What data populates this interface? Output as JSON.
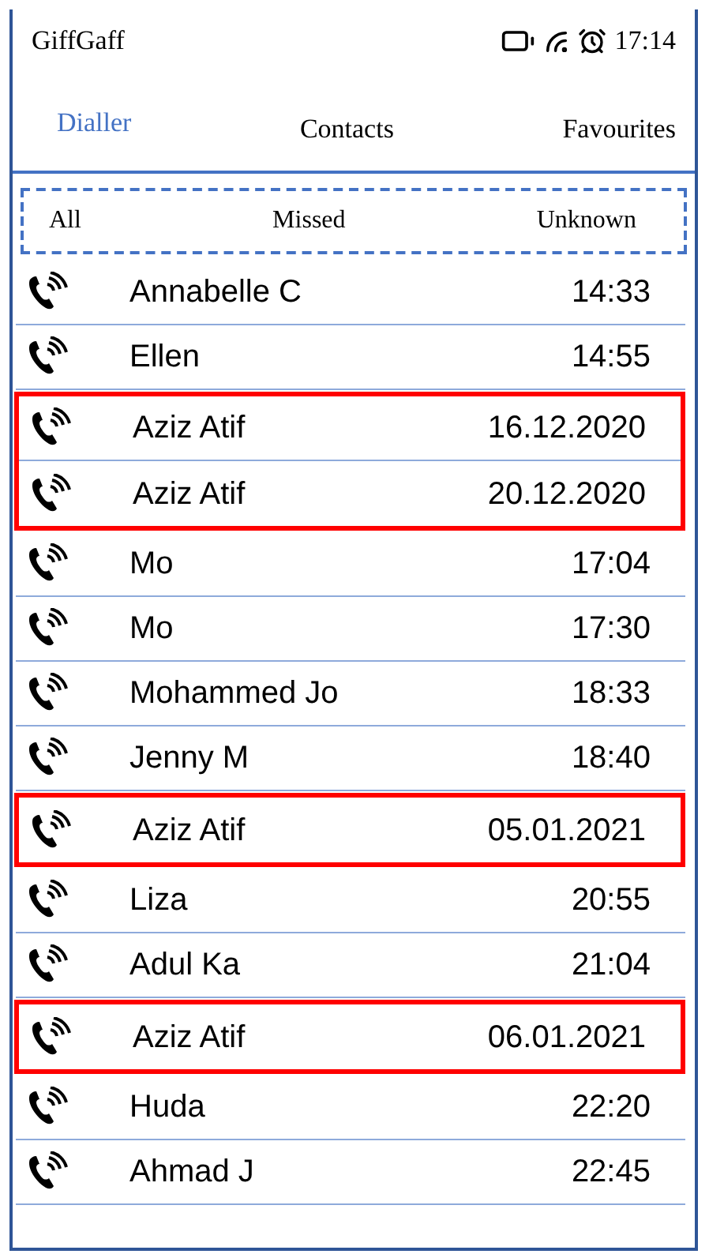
{
  "status_bar": {
    "carrier": "GiffGaff",
    "time": "17:14"
  },
  "tabs": [
    {
      "label": "Dialler",
      "selected": true
    },
    {
      "label": "Contacts",
      "selected": false
    },
    {
      "label": "Favourites",
      "selected": false
    }
  ],
  "filters": [
    "All",
    "Missed",
    "Unknown"
  ],
  "calls": [
    {
      "name": "Annabelle C",
      "time": "14:33",
      "highlighted": false
    },
    {
      "name": "Ellen",
      "time": "14:55",
      "highlighted": false
    },
    {
      "name": "Aziz Atif",
      "time": "16.12.2020",
      "highlighted": true
    },
    {
      "name": "Aziz Atif",
      "time": "20.12.2020",
      "highlighted": true
    },
    {
      "name": "Mo",
      "time": "17:04",
      "highlighted": false
    },
    {
      "name": "Mo",
      "time": "17:30",
      "highlighted": false
    },
    {
      "name": "Mohammed Jo",
      "time": "18:33",
      "highlighted": false
    },
    {
      "name": "Jenny M",
      "time": "18:40",
      "highlighted": false
    },
    {
      "name": "Aziz Atif",
      "time": "05.01.2021",
      "highlighted": true
    },
    {
      "name": "Liza",
      "time": "20:55",
      "highlighted": false
    },
    {
      "name": "Adul Ka",
      "time": "21:04",
      "highlighted": false
    },
    {
      "name": "Aziz Atif",
      "time": "06.01.2021",
      "highlighted": true
    },
    {
      "name": "Huda",
      "time": "22:20",
      "highlighted": false
    },
    {
      "name": "Ahmad J",
      "time": "22:45",
      "highlighted": false
    }
  ]
}
